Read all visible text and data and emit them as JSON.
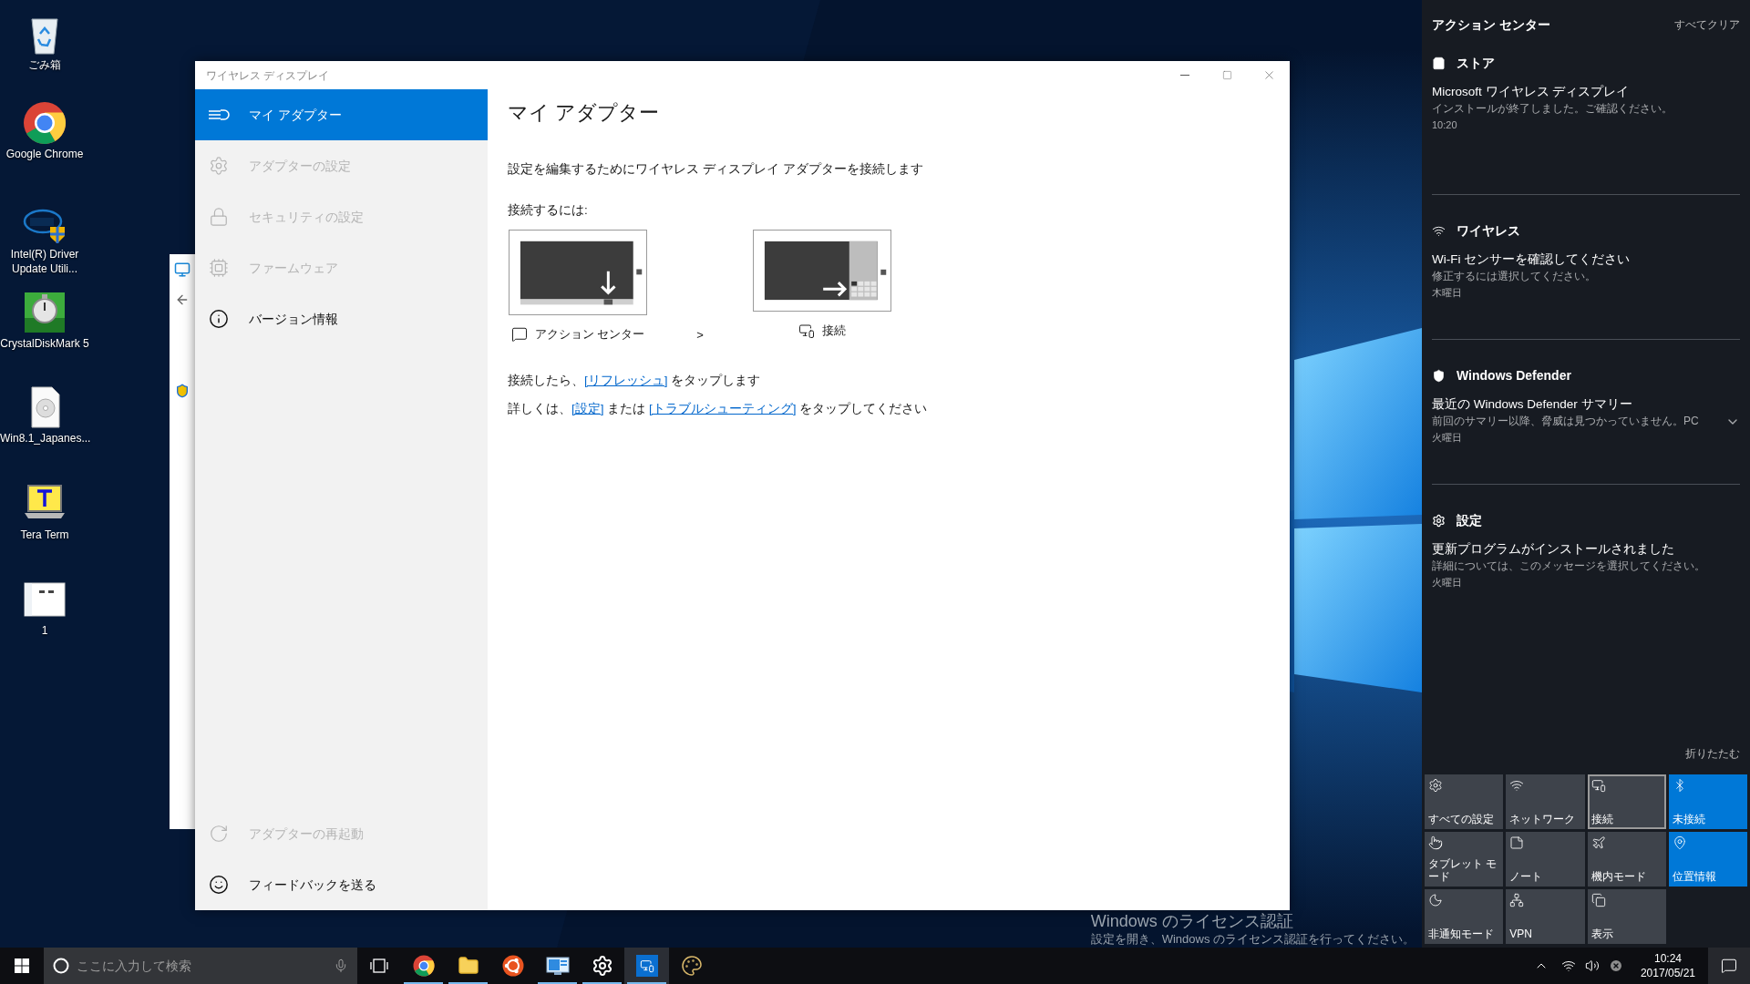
{
  "desktop_icons": [
    {
      "label": "ごみ箱"
    },
    {
      "label": "Google Chrome"
    },
    {
      "label": "Intel(R) Driver Update Utili..."
    },
    {
      "label": "CrystalDiskMark 5"
    },
    {
      "label": "Win8.1_Japanes..."
    },
    {
      "label": "Tera Term"
    },
    {
      "label": "1"
    }
  ],
  "window": {
    "title": "ワイヤレス ディスプレイ",
    "nav": [
      {
        "label": "マイ アダプター",
        "selected": true,
        "disabled": false
      },
      {
        "label": "アダプターの設定",
        "selected": false,
        "disabled": true
      },
      {
        "label": "セキュリティの設定",
        "selected": false,
        "disabled": true
      },
      {
        "label": "ファームウェア",
        "selected": false,
        "disabled": true
      },
      {
        "label": "バージョン情報",
        "selected": false,
        "disabled": false
      }
    ],
    "nav_bottom": [
      {
        "label": "アダプターの再起動",
        "disabled": true
      },
      {
        "label": "フィードバックを送る",
        "disabled": false
      }
    ],
    "heading": "マイ アダプター",
    "intro": "設定を編集するためにワイヤレス ディスプレイ アダプターを接続します",
    "steps_label": "接続するには:",
    "steps": [
      {
        "label": "アクション センター"
      },
      {
        "label": "接続"
      }
    ],
    "step_separator": ">",
    "lines": [
      [
        {
          "kind": "text",
          "text": "接続したら、"
        },
        {
          "kind": "link",
          "text": "[リフレッシュ]"
        },
        {
          "kind": "text",
          "text": " をタップします"
        }
      ],
      [
        {
          "kind": "text",
          "text": "詳しくは、"
        },
        {
          "kind": "link",
          "text": "[設定]"
        },
        {
          "kind": "text",
          "text": " または "
        },
        {
          "kind": "link",
          "text": "[トラブルシューティング]"
        },
        {
          "kind": "text",
          "text": " をタップしてください"
        }
      ]
    ]
  },
  "action_center": {
    "title": "アクション センター",
    "clear_all": "すべてクリア",
    "notifications": [
      {
        "app": "ストア",
        "title": "Microsoft ワイヤレス ディスプレイ",
        "body": "インストールが終了しました。ご確認ください。",
        "time": "10:20",
        "expandable": false
      },
      {
        "app": "ワイヤレス",
        "title": "Wi-Fi センサーを確認してください",
        "body": "修正するには選択してください。",
        "time": "木曜日",
        "expandable": false
      },
      {
        "app": "Windows Defender",
        "title": "最近の Windows Defender サマリー",
        "body": "前回のサマリー以降、脅威は見つかっていません。PC",
        "time": "火曜日",
        "expandable": true
      },
      {
        "app": "設定",
        "title": "更新プログラムがインストールされました",
        "body": "詳細については、このメッセージを選択してください。",
        "time": "火曜日",
        "expandable": false
      }
    ],
    "collapse": "折りたたむ",
    "quick_actions": [
      {
        "label": "すべての設定",
        "on": false,
        "focused": false
      },
      {
        "label": "ネットワーク",
        "on": false,
        "focused": false
      },
      {
        "label": "接続",
        "on": false,
        "focused": true
      },
      {
        "label": "未接続",
        "on": true,
        "focused": false
      },
      {
        "label": "タブレット モード",
        "on": false,
        "focused": false
      },
      {
        "label": "ノート",
        "on": false,
        "focused": false
      },
      {
        "label": "機内モード",
        "on": false,
        "focused": false
      },
      {
        "label": "位置情報",
        "on": true,
        "focused": false
      },
      {
        "label": "非通知モード",
        "on": false,
        "focused": false
      },
      {
        "label": "VPN",
        "on": false,
        "focused": false
      },
      {
        "label": "表示",
        "on": false,
        "focused": false
      }
    ]
  },
  "activation_notice": {
    "title": "Windows のライセンス認証",
    "body": "設定を開き、Windows のライセンス認証を行ってください。"
  },
  "taskbar": {
    "search": {
      "placeholder": "ここに入力して検索"
    },
    "apps": [
      {
        "kind": "chrome",
        "running": true,
        "active": false
      },
      {
        "kind": "explorer",
        "running": true,
        "active": false
      },
      {
        "kind": "ubuntu",
        "running": false,
        "active": false
      },
      {
        "kind": "remote",
        "running": true,
        "active": false
      },
      {
        "kind": "settings",
        "running": true,
        "active": false
      },
      {
        "kind": "wireless",
        "running": true,
        "active": true
      },
      {
        "kind": "paint",
        "running": false,
        "active": false
      }
    ],
    "time": "10:24",
    "date": "2017/05/21"
  }
}
